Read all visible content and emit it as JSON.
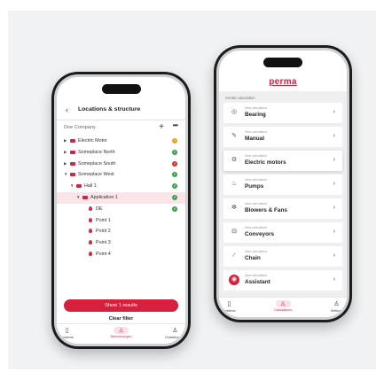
{
  "left_phone": {
    "header": {
      "back_icon": "chevron-left-icon",
      "title": "Locations & structure"
    },
    "company": {
      "name": "Doe Company",
      "add_icon": "plus-icon",
      "more_icon": "more-icon"
    },
    "tree": [
      {
        "label": "Electric Motor",
        "type": "folder",
        "indent": 0,
        "expanded": false,
        "status": "warn",
        "status_text": "!"
      },
      {
        "label": "Someplace North",
        "type": "folder",
        "indent": 0,
        "expanded": false,
        "status": "ok",
        "status_text": "✓"
      },
      {
        "label": "Someplace South",
        "type": "folder",
        "indent": 0,
        "expanded": false,
        "status": "err",
        "status_text": "!"
      },
      {
        "label": "Someplace West",
        "type": "folder",
        "indent": 0,
        "expanded": true,
        "status": "ok",
        "status_text": "✓"
      },
      {
        "label": "Hall 1",
        "type": "folder",
        "indent": 1,
        "expanded": true,
        "status": "ok",
        "status_text": "✓"
      },
      {
        "label": "Application 1",
        "type": "folder",
        "indent": 2,
        "expanded": true,
        "status": "ok",
        "status_text": "✓",
        "selected": true
      },
      {
        "label": "DE",
        "type": "point",
        "indent": 3,
        "status": "ok",
        "status_text": "✓"
      },
      {
        "label": "Point 1",
        "type": "point",
        "indent": 3
      },
      {
        "label": "Point 2",
        "type": "point",
        "indent": 3
      },
      {
        "label": "Point 3",
        "type": "point",
        "indent": 3
      },
      {
        "label": "Point 4",
        "type": "point",
        "indent": 3
      }
    ],
    "show_button": "Show 1 results",
    "clear_button": "Clear filter",
    "nav": [
      {
        "label": "Systeme",
        "icon": "device-icon",
        "glyph": "▯"
      },
      {
        "label": "Berechnungen",
        "icon": "drop-icon",
        "glyph": "◬",
        "active": true
      },
      {
        "label": "Einstellungen",
        "icon": "user-icon",
        "glyph": "♙"
      }
    ]
  },
  "right_phone": {
    "brand": "perma",
    "section_title": "Create calculation",
    "cards": [
      {
        "subtitle": "New calculation",
        "title": "Bearing",
        "icon": "bearing-icon",
        "glyph": "◎"
      },
      {
        "subtitle": "New calculation",
        "title": "Manual",
        "icon": "manual-icon",
        "glyph": "✎"
      },
      {
        "subtitle": "New calculation",
        "title": "Electric motors",
        "icon": "motor-icon",
        "glyph": "⚙",
        "highlighted": true
      },
      {
        "subtitle": "New calculation",
        "title": "Pumps",
        "icon": "pump-icon",
        "glyph": "♨"
      },
      {
        "subtitle": "New calculation",
        "title": "Blowers & Fans",
        "icon": "fan-icon",
        "glyph": "✻"
      },
      {
        "subtitle": "New calculation",
        "title": "Conveyors",
        "icon": "conveyor-icon",
        "glyph": "⊟"
      },
      {
        "subtitle": "New calculation",
        "title": "Chain",
        "icon": "chain-icon",
        "glyph": "∕"
      },
      {
        "subtitle": "New calculation",
        "title": "Assistant",
        "icon": "assistant-icon",
        "glyph": "◉",
        "red": true
      }
    ],
    "chevron": "›",
    "nav": [
      {
        "label": "Systems",
        "icon": "device-icon",
        "glyph": "▯"
      },
      {
        "label": "Calculations",
        "icon": "drop-icon",
        "glyph": "◬",
        "active": true
      },
      {
        "label": "Settings",
        "icon": "user-icon",
        "glyph": "♙"
      }
    ]
  },
  "colors": {
    "brand": "#d6203e",
    "ok": "#3aa14b",
    "warn": "#e8a02a",
    "err": "#d9342c"
  }
}
